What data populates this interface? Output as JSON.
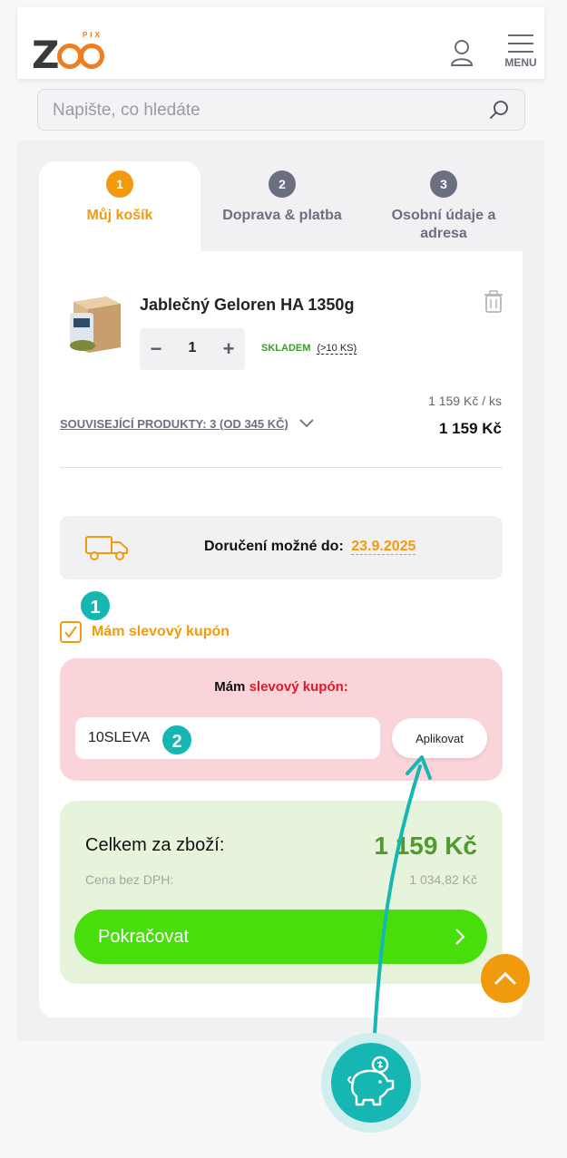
{
  "header": {
    "logo_text": "ZOO",
    "logo_sub": "PIX",
    "menu_label": "MENU"
  },
  "search": {
    "placeholder": "Napište, co hledáte"
  },
  "steps": [
    {
      "number": "1",
      "label": "Můj košík",
      "active": true
    },
    {
      "number": "2",
      "label": "Doprava & platba",
      "active": false
    },
    {
      "number": "3",
      "label": "Osobní údaje a adresa",
      "active": false
    }
  ],
  "cart_item": {
    "name": "Jablečný Geloren HA 1350g",
    "quantity": "1",
    "stock_label": "SKLADEM",
    "stock_count": "(>10 KS)",
    "unit_price": "1 159 Kč  / ks",
    "total": "1 159 Kč",
    "related": "SOUVISEJÍCÍ PRODUKTY: 3 (OD 345 KČ)"
  },
  "delivery": {
    "label": "Doručení možné do:",
    "date": "23.9.2025"
  },
  "coupon": {
    "checkbox_label": "Mám slevový kupón",
    "title_prefix": "Mám",
    "title_accent": "slevový kupón:",
    "code": "10SLEVA",
    "apply_label": "Aplikovat",
    "badge_1": "1",
    "badge_2": "2"
  },
  "summary": {
    "total_label": "Celkem za zboží:",
    "total_value": "1 159 Kč",
    "net_label": "Cena bez DPH:",
    "net_value": "1 034,82 Kč",
    "continue_label": "Pokračovat"
  },
  "colors": {
    "accent_orange": "#f29a0e",
    "teal": "#16b7b3",
    "green_button": "#47de0c",
    "coupon_bg": "#fad4d8",
    "summary_bg": "#e6f4dc"
  },
  "icons": [
    "user-icon",
    "hamburger-menu-icon",
    "search-icon",
    "trash-icon",
    "truck-icon",
    "checkmark-icon",
    "chevron-down-icon",
    "chevron-right-icon",
    "chevron-up-icon",
    "piggy-bank-icon"
  ]
}
